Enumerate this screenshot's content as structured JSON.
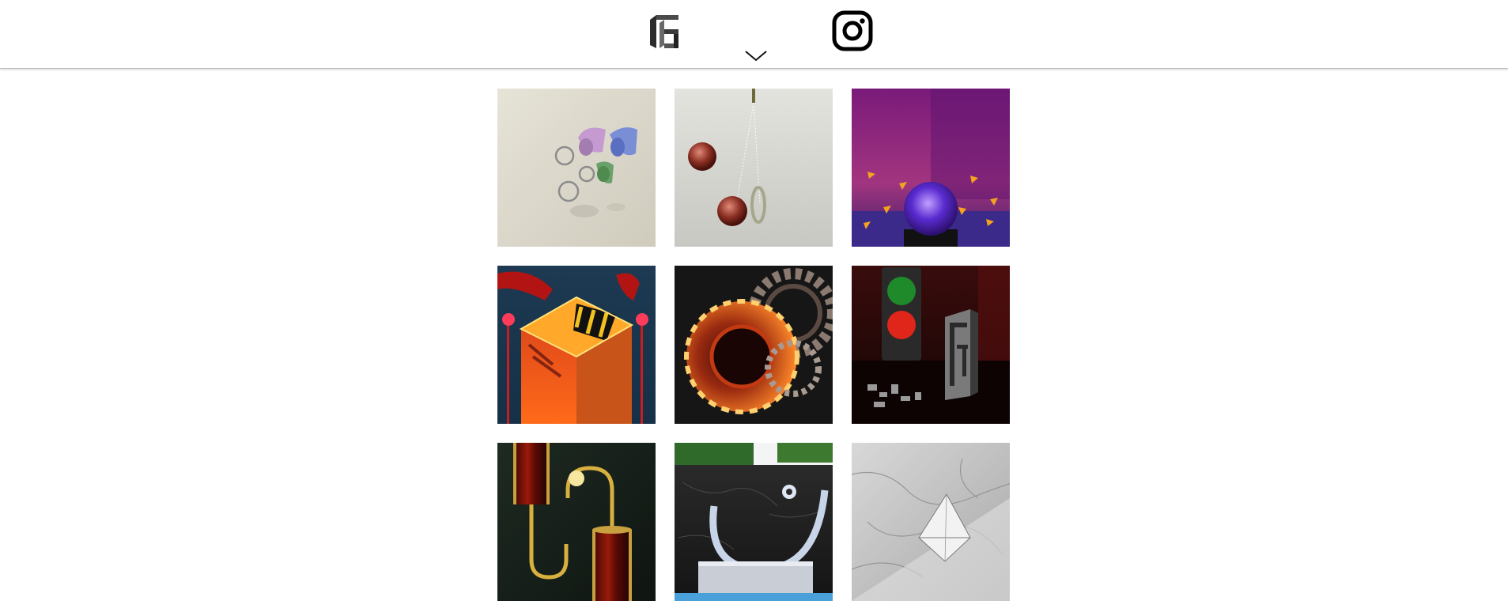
{
  "header": {
    "logo_icon": "kg-monogram-logo-icon",
    "menu_toggle_icon": "chevron-down-icon",
    "social_icon": "instagram-icon",
    "colors": {
      "background": "#ffffff",
      "icon": "#111111",
      "divider": "#bdbdbd"
    }
  },
  "gallery": {
    "items": [
      {
        "icon": "pastel-tubes-and-rings-render"
      },
      {
        "icon": "glass-spheres-pendulum-render"
      },
      {
        "icon": "purple-glowing-orb-render"
      },
      {
        "icon": "hazard-box-neon-render"
      },
      {
        "icon": "fiery-gears-render"
      },
      {
        "icon": "traffic-light-logo-render"
      },
      {
        "icon": "gold-hooks-cylinders-render"
      },
      {
        "icon": "marble-crescent-sculpture-render"
      },
      {
        "icon": "marble-diamond-slab-render"
      }
    ]
  }
}
